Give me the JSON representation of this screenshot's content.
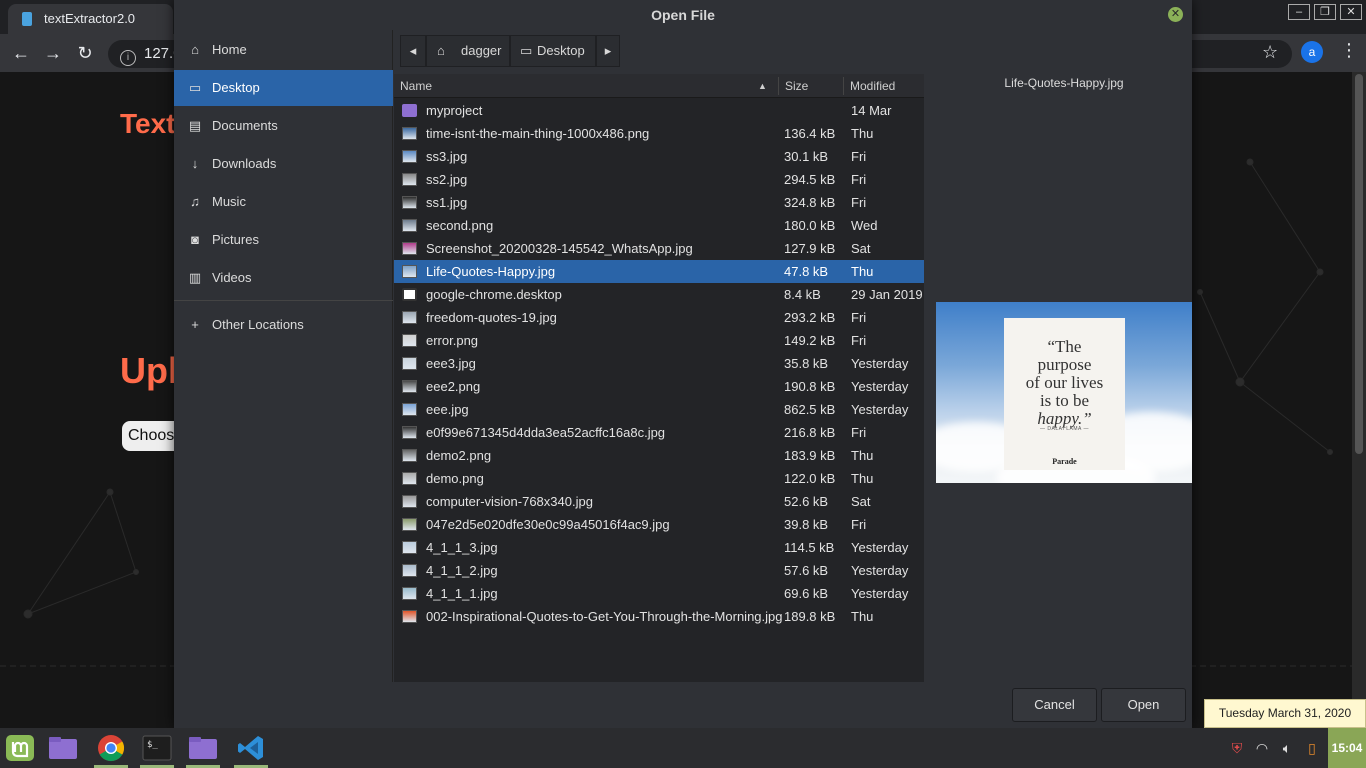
{
  "browser": {
    "tab_title": "textExtractor2.0",
    "url": "127.0",
    "profile_initial": "a",
    "page_heading": "Text",
    "page_upload": "Upl",
    "page_choose": "Choos"
  },
  "dialog": {
    "title": "Open File",
    "places": [
      {
        "label": "Home",
        "icon": "home-icon"
      },
      {
        "label": "Desktop",
        "icon": "desktop-icon",
        "selected": true
      },
      {
        "label": "Documents",
        "icon": "document-icon"
      },
      {
        "label": "Downloads",
        "icon": "download-icon"
      },
      {
        "label": "Music",
        "icon": "music-icon"
      },
      {
        "label": "Pictures",
        "icon": "camera-icon"
      },
      {
        "label": "Videos",
        "icon": "film-icon"
      },
      {
        "label": "Other Locations",
        "icon": "plus-icon"
      }
    ],
    "path": [
      "dagger",
      "Desktop"
    ],
    "columns": {
      "name": "Name",
      "size": "Size",
      "modified": "Modified"
    },
    "files": [
      {
        "name": "myproject",
        "size": "",
        "modified": "14 Mar",
        "kind": "folder"
      },
      {
        "name": "time-isnt-the-main-thing-1000x486.png",
        "size": "136.4 kB",
        "modified": "Thu",
        "kind": "image"
      },
      {
        "name": "ss3.jpg",
        "size": "30.1 kB",
        "modified": "Fri",
        "kind": "image"
      },
      {
        "name": "ss2.jpg",
        "size": "294.5 kB",
        "modified": "Fri",
        "kind": "image"
      },
      {
        "name": "ss1.jpg",
        "size": "324.8 kB",
        "modified": "Fri",
        "kind": "image"
      },
      {
        "name": "second.png",
        "size": "180.0 kB",
        "modified": "Wed",
        "kind": "image"
      },
      {
        "name": "Screenshot_20200328-145542_WhatsApp.jpg",
        "size": "127.9 kB",
        "modified": "Sat",
        "kind": "image"
      },
      {
        "name": "Life-Quotes-Happy.jpg",
        "size": "47.8 kB",
        "modified": "Thu",
        "kind": "image",
        "selected": true
      },
      {
        "name": "google-chrome.desktop",
        "size": "8.4 kB",
        "modified": "29 Jan 2019",
        "kind": "desktop"
      },
      {
        "name": "freedom-quotes-19.jpg",
        "size": "293.2 kB",
        "modified": "Fri",
        "kind": "image"
      },
      {
        "name": "error.png",
        "size": "149.2 kB",
        "modified": "Fri",
        "kind": "image"
      },
      {
        "name": "eee3.jpg",
        "size": "35.8 kB",
        "modified": "Yesterday",
        "kind": "image"
      },
      {
        "name": "eee2.png",
        "size": "190.8 kB",
        "modified": "Yesterday",
        "kind": "image"
      },
      {
        "name": "eee.jpg",
        "size": "862.5 kB",
        "modified": "Yesterday",
        "kind": "image"
      },
      {
        "name": "e0f99e671345d4dda3ea52acffc16a8c.jpg",
        "size": "216.8 kB",
        "modified": "Fri",
        "kind": "image"
      },
      {
        "name": "demo2.png",
        "size": "183.9 kB",
        "modified": "Thu",
        "kind": "image"
      },
      {
        "name": "demo.png",
        "size": "122.0 kB",
        "modified": "Thu",
        "kind": "image"
      },
      {
        "name": "computer-vision-768x340.jpg",
        "size": "52.6 kB",
        "modified": "Sat",
        "kind": "image"
      },
      {
        "name": "047e2d5e020dfe30e0c99a45016f4ac9.jpg",
        "size": "39.8 kB",
        "modified": "Fri",
        "kind": "image"
      },
      {
        "name": "4_1_1_3.jpg",
        "size": "114.5 kB",
        "modified": "Yesterday",
        "kind": "image"
      },
      {
        "name": "4_1_1_2.jpg",
        "size": "57.6 kB",
        "modified": "Yesterday",
        "kind": "image"
      },
      {
        "name": "4_1_1_1.jpg",
        "size": "69.6 kB",
        "modified": "Yesterday",
        "kind": "image"
      },
      {
        "name": "002-Inspirational-Quotes-to-Get-You-Through-the-Morning.jpg",
        "size": "189.8 kB",
        "modified": "Thu",
        "kind": "image"
      }
    ],
    "preview": {
      "filename": "Life-Quotes-Happy.jpg",
      "quote_line1": "“The",
      "quote_line2": "purpose",
      "quote_line3": "of our lives",
      "quote_line4": "is to be",
      "quote_line5": "happy.”",
      "author": "— DALAI LAMA —",
      "brand": "Parade"
    },
    "cancel_label": "Cancel",
    "open_label": "Open"
  },
  "taskbar": {
    "clock": "15:04",
    "date_tooltip": "Tuesday March 31, 2020"
  },
  "colors": {
    "accent": "#2a64a8",
    "mint_green": "#8aa656",
    "page_orange": "#ff6b4a"
  }
}
